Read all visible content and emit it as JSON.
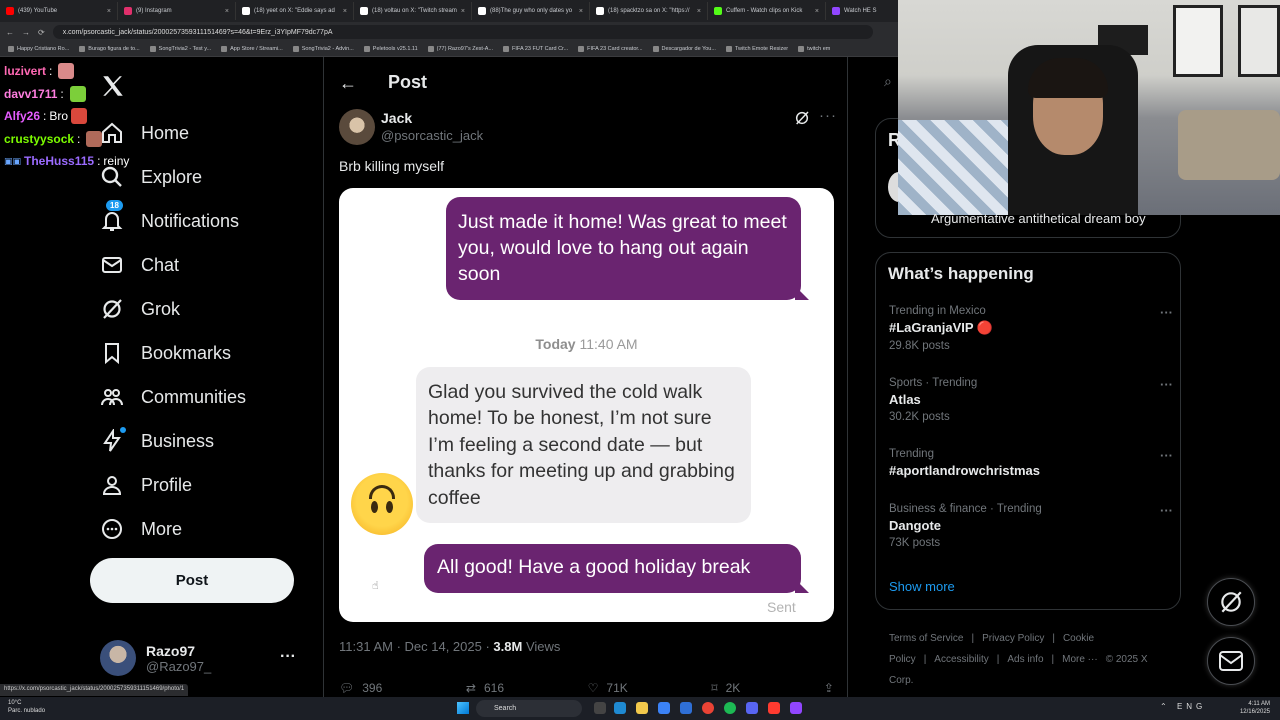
{
  "browser": {
    "tabs": [
      {
        "label": "(439) YouTube",
        "color": "#ff0000"
      },
      {
        "label": "(9) Instagram",
        "color": "#e1306c"
      },
      {
        "label": "(18) yeet on X: \"Eddie says ad",
        "color": "#ffffff"
      },
      {
        "label": "(18) voltau on X: \"Twitch stream",
        "color": "#ffffff"
      },
      {
        "label": "(88)The guy who only dates yo",
        "color": "#ffffff"
      },
      {
        "label": "(18) spacktzo sa on X: \"https://",
        "color": "#ffffff"
      },
      {
        "label": "Cuffem - Watch clips on Kick",
        "color": "#53fc18"
      },
      {
        "label": "Watch HE S",
        "color": "#9146ff"
      }
    ],
    "url": "x.com/psorcastic_jack/status/2000257359311151469?s=46&t=9Erz_i3YIpMF79dc77pA",
    "bookmarks": [
      "Happy Cristiano Ro...",
      "Burago figura de to...",
      "SongTrivia2 - Test y...",
      "App Store / Streami...",
      "SongTrivia2 - Advin...",
      "Peletools v25.1.11",
      "(77) Razo97's Zest-A...",
      "FIFA 23 FUT Card Cr...",
      "FIFA 23 Card creator...",
      "Descargador de You...",
      "Twitch Emote Resizer",
      "twitch em"
    ],
    "status_url": "https://x.com/psorcastic_jack/status/2000257359311151469/photo/1"
  },
  "chat": [
    {
      "user": "luzivert",
      "color": "#ff69b4",
      "msg": "",
      "emote": "#d98a8a"
    },
    {
      "user": "davv1711",
      "color": "#ff7ee0",
      "msg": "",
      "emote": "#7ccf3a"
    },
    {
      "user": "Alfy26",
      "color": "#e65cff",
      "msg": "Bro",
      "emote": "#d9483c"
    },
    {
      "user": "crustyysock",
      "color": "#7cfc00",
      "msg": "",
      "emote": "#b06a5a"
    },
    {
      "user": "TheHuss115",
      "color": "#9b6bff",
      "msg": "reiny",
      "emote": ""
    }
  ],
  "nav": {
    "items": [
      {
        "label": "Home",
        "icon": "home-icon"
      },
      {
        "label": "Explore",
        "icon": "search-icon"
      },
      {
        "label": "Notifications",
        "icon": "bell-icon",
        "badge": "18"
      },
      {
        "label": "Chat",
        "icon": "mail-icon"
      },
      {
        "label": "Grok",
        "icon": "grok-icon"
      },
      {
        "label": "Bookmarks",
        "icon": "bookmark-icon"
      },
      {
        "label": "Communities",
        "icon": "people-icon"
      },
      {
        "label": "Business",
        "icon": "lightning-icon"
      },
      {
        "label": "Profile",
        "icon": "person-icon"
      },
      {
        "label": "More",
        "icon": "more-circle-icon"
      }
    ],
    "post_button": "Post",
    "account": {
      "name": "Razo97",
      "handle": "@Razo97_"
    }
  },
  "post": {
    "header": "Post",
    "author_name": "Jack",
    "author_handle": "@psorcastic_jack",
    "text": "Brb killing myself",
    "image": {
      "bubble1": "Just made it home! Was great to meet you, would love to hang out again soon",
      "timestamp_day": "Today",
      "timestamp_time": "11:40 AM",
      "bubble2": "Glad you survived the cold walk home! To be honest, I’m not sure I’m feeling a second date — but thanks for meeting up and grabbing coffee",
      "bubble3": "All good! Have a good holiday break",
      "sent_label": "Sent"
    },
    "time": "11:31 AM · Dec 14, 2025 · ",
    "views": "3.8M",
    "views_label": "Views",
    "replies": "396",
    "reposts": "616",
    "likes": "71K",
    "bookmarks": "2K"
  },
  "right": {
    "relevant_letter": "R",
    "relevant_bio": "Argumentative antithetical dream boy",
    "happening_title": "What’s happening",
    "trends": [
      {
        "category": "Trending in Mexico",
        "tag": "#LaGranjaVIP 🔴",
        "count": "29.8K posts"
      },
      {
        "category": "Sports · Trending",
        "tag": "Atlas",
        "count": "30.2K posts"
      },
      {
        "category": "Trending",
        "tag": "#aportlandrowchristmas",
        "count": ""
      },
      {
        "category": "Business & finance · Trending",
        "tag": "Dangote",
        "count": "73K posts"
      }
    ],
    "show_more": "Show more",
    "footer": [
      "Terms of Service",
      "|",
      "Privacy Policy",
      "|",
      "Cookie Policy",
      "|",
      "Accessibility",
      "|",
      "Ads info",
      "|",
      "More ···",
      "© 2025 X Corp."
    ]
  },
  "taskbar": {
    "weather_temp": "10°C",
    "weather_desc": "Parc. nublado",
    "search": "Search",
    "lang": "ENG",
    "time": "4:11 AM",
    "date": "12/16/2025"
  }
}
